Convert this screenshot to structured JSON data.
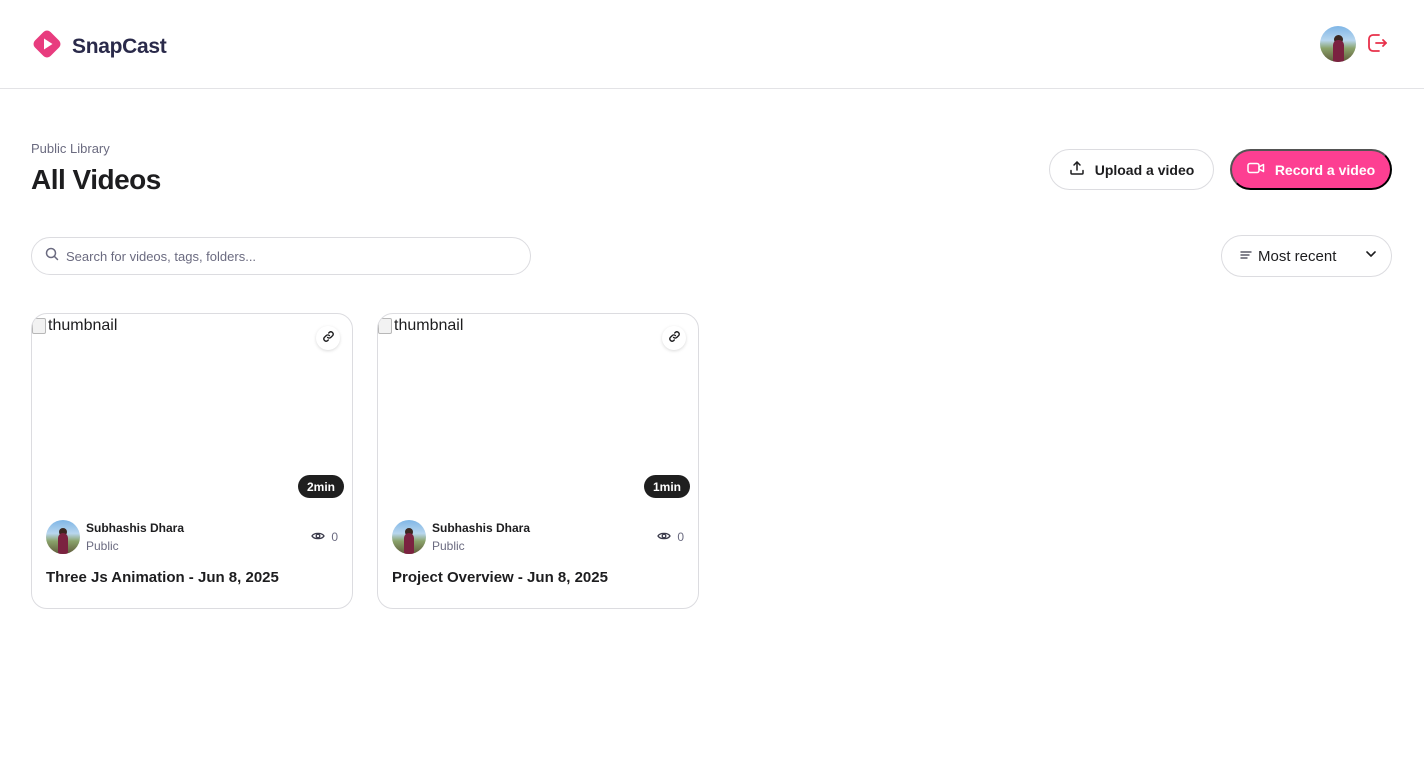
{
  "app": {
    "name": "SnapCast",
    "brand_color": "#fd3f92",
    "logo_icon": "play-diamond-icon"
  },
  "header": {
    "avatar_alt": "user-avatar",
    "logout_icon": "logout-icon"
  },
  "page": {
    "subtitle": "Public Library",
    "title": "All Videos"
  },
  "actions": {
    "upload_label": "Upload a video",
    "upload_icon": "upload-icon",
    "record_label": "Record a video",
    "record_icon": "video-camera-icon"
  },
  "search": {
    "placeholder": "Search for videos, tags, folders...",
    "value": "",
    "icon": "search-icon"
  },
  "sort": {
    "label": "Most recent",
    "icon": "filter-lines-icon",
    "chevron": "chevron-down-icon"
  },
  "videos": [
    {
      "thumbnail_alt": "thumbnail",
      "duration": "2min",
      "author": "Subhashis Dhara",
      "visibility": "Public",
      "views": "0",
      "title": "Three Js Animation - Jun 8, 2025"
    },
    {
      "thumbnail_alt": "thumbnail",
      "duration": "1min",
      "author": "Subhashis Dhara",
      "visibility": "Public",
      "views": "0",
      "title": "Project Overview - Jun 8, 2025"
    }
  ]
}
